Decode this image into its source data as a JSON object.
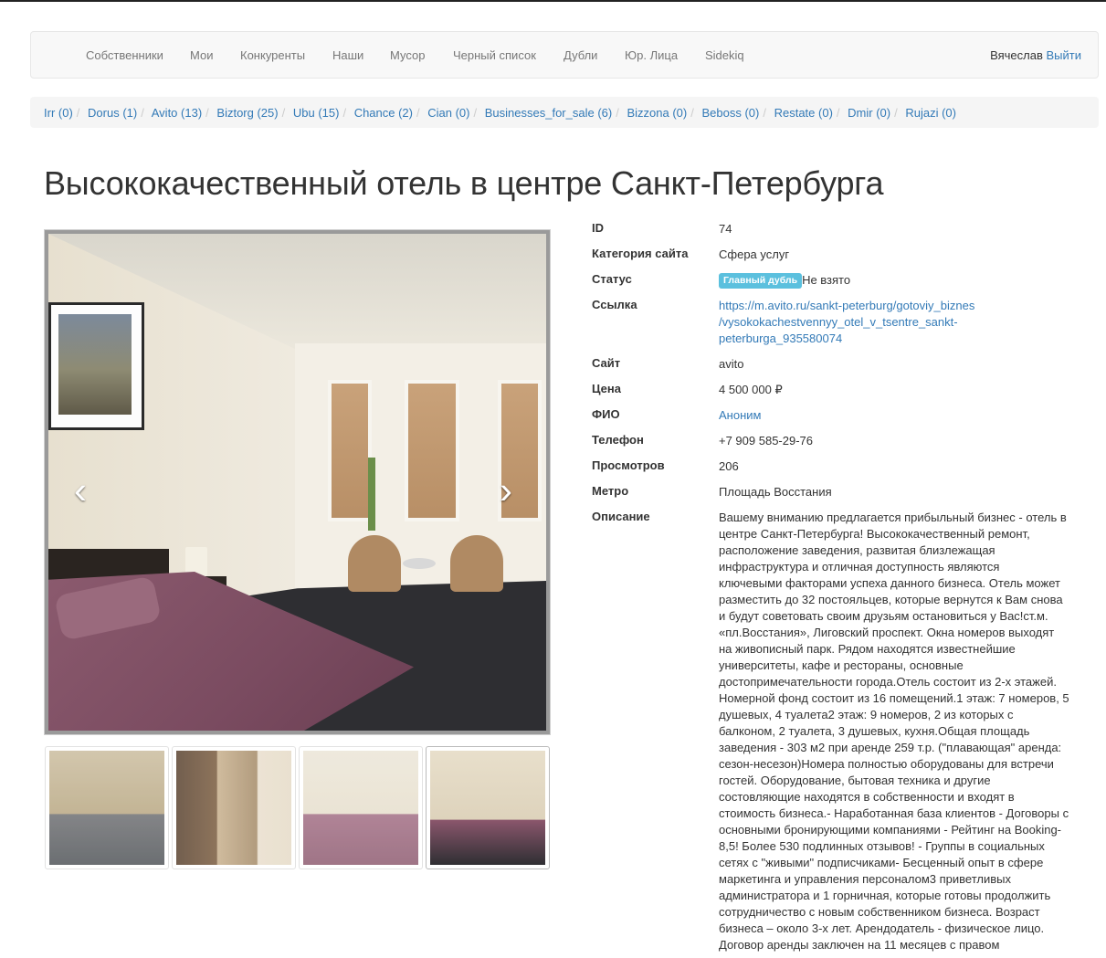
{
  "nav": {
    "items": [
      "Собственники",
      "Мои",
      "Конкуренты",
      "Наши",
      "Мусор",
      "Черный список",
      "Дубли",
      "Юр. Лица",
      "Sidekiq"
    ],
    "user_name": "Вячеслав",
    "logout_label": "Выйти"
  },
  "sources": [
    "Irr (0)",
    "Dorus (1)",
    "Avito (13)",
    "Biztorg (25)",
    "Ubu (15)",
    "Chance (2)",
    "Cian (0)",
    "Businesses_for_sale (6)",
    "Bizzona (0)",
    "Beboss (0)",
    "Restate (0)",
    "Dmir (0)",
    "Rujazi (0)"
  ],
  "title": "Высококачественный отель в центре Санкт-Петербурга",
  "carousel": {
    "prev_glyph": "‹",
    "next_glyph": "›",
    "thumb_count": 4,
    "active_thumb": 4
  },
  "details": {
    "id_label": "ID",
    "id_value": "74",
    "category_label": "Категория сайта",
    "category_value": "Сфера услуг",
    "status_label": "Статус",
    "status_badge": "Главный дубль",
    "status_value": "Не взято",
    "link_label": "Ссылка",
    "link_value": "https://m.avito.ru/sankt-peterburg/gotoviy_biznes/vysokokachestvennyy_otel_v_tsentre_sankt-peterburga_935580074",
    "link_lines": [
      "https://m.avito.ru/sankt-peterburg/gotoviy_biznes",
      "/vysokokachestvennyy_otel_v_tsentre_sankt-",
      "peterburga_935580074"
    ],
    "site_label": "Сайт",
    "site_value": "avito",
    "price_label": "Цена",
    "price_value": "4 500 000 ₽",
    "fio_label": "ФИО",
    "fio_value": "Аноним",
    "phone_label": "Телефон",
    "phone_value": "+7 909 585-29-76",
    "views_label": "Просмотров",
    "views_value": "206",
    "metro_label": "Метро",
    "metro_value": "Площадь Восстания",
    "description_label": "Описание",
    "description_lines": [
      "Вашему вниманию предлагается прибыльный бизнес - отель в",
      "центре Санкт-Петербурга! Высококачественный ремонт,",
      "расположение заведения, развитая близлежащая",
      "инфраструктура и отличная доступность являются",
      "ключевыми факторами успеха данного бизнеса. Отель может",
      "разместить до 32 постояльцев, которые вернутся к Вам снова",
      "и будут советовать своим друзьям остановиться у Вас!ст.м.",
      "«пл.Восстания», Лиговский проспект. Окна номеров выходят",
      "на живописный парк. Рядом находятся известнейшие",
      "университеты, кафе и рестораны, основные",
      "достопримечательности города.Отель состоит из 2-х этажей.",
      "Номерной фонд состоит из 16 помещений.1 этаж: 7 номеров, 5",
      "душевых, 4 туалета2 этаж: 9 номеров, 2 из которых с",
      "балконом, 2 туалета, 3 душевых, кухня.Общая площадь",
      "заведения - 303 м2 при аренде 259 т.р. (\"плавающая\" аренда:",
      "сезон-несезон)Номера полностью оборудованы для встречи",
      "гостей. Оборудование, бытовая техника и другие",
      "состовляющие находятся в собственности и входят в",
      "стоимость бизнеса.- Наработанная база клиентов - Договоры с",
      "основными бронирующими компаниями - Рейтинг на Booking-",
      "8,5! Более 530 подлинных отзывов! - Группы в социальных",
      "сетях с \"живыми\" подписчиками- Бесценный опыт в сфере",
      "маркетинга и управления персоналом3 приветливых",
      "администратора и 1 горничная, которые готовы продолжить",
      "сотрудничество с новым собственником бизнеса. Возраст",
      "бизнеса – около 3-х лет. Арендодатель - физическое лицо.",
      "Договор аренды заключен на 11 месяцев с правом"
    ]
  },
  "colors": {
    "link": "#337ab7",
    "badge": "#5bc0de",
    "navbar_bg": "#f8f8f8",
    "breadcrumb_bg": "#f5f5f5"
  }
}
